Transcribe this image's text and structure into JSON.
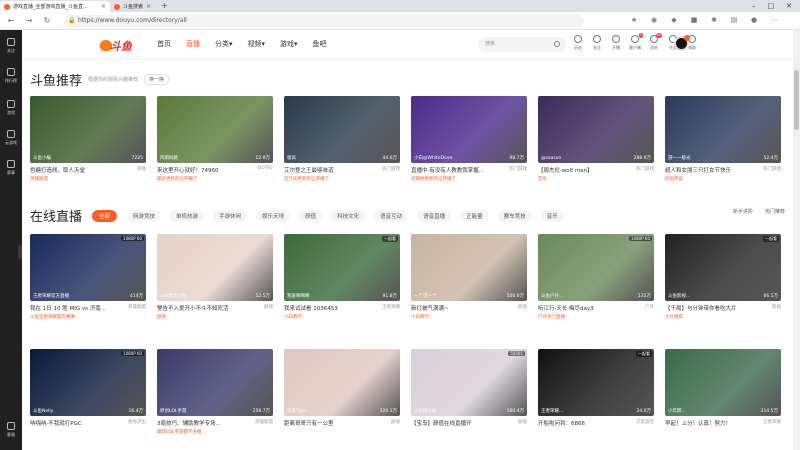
{
  "browser": {
    "tabs": [
      {
        "title": "游戏直播_全部游戏直播_斗鱼直...",
        "active": true
      },
      {
        "title": "斗鱼搜索",
        "active": false
      }
    ],
    "url": "https://www.douyu.com/directory/all",
    "new_tab": "+"
  },
  "sidebar": {
    "items": [
      {
        "label": "关注",
        "icon": "heart-icon"
      },
      {
        "label": "排行榜",
        "icon": "rank-icon"
      },
      {
        "label": "游戏",
        "icon": "game-icon"
      },
      {
        "label": "云游戏",
        "icon": "cloud-game-icon"
      },
      {
        "label": "赛事",
        "icon": "trophy-icon"
      },
      {
        "label": "客服",
        "icon": "support-icon"
      }
    ]
  },
  "header": {
    "logo_text": "斗鱼",
    "nav": [
      {
        "label": "首页"
      },
      {
        "label": "直播",
        "active": true
      },
      {
        "label": "分类▾"
      },
      {
        "label": "视频▾"
      },
      {
        "label": "游戏▾"
      },
      {
        "label": "鱼吧"
      }
    ],
    "search_placeholder": "搜索",
    "tools": [
      {
        "label": "历史",
        "badge": ""
      },
      {
        "label": "关注",
        "badge": ""
      },
      {
        "label": "开播",
        "badge": ""
      },
      {
        "label": "客户端",
        "badge": "1"
      },
      {
        "label": "消息",
        "badge": "99"
      },
      {
        "label": "任务",
        "badge": ""
      },
      {
        "label": "领取",
        "badge": ""
      }
    ]
  },
  "recommend": {
    "title": "斗鱼推荐",
    "subtitle": "根据你的观看兴趣推荐",
    "refresh": "换一换",
    "cards": [
      {
        "title": "色糖打造线，取人天堂",
        "category": "英雄",
        "anchor": "斗鱼小编",
        "viewers": "7225",
        "note": "英雄联盟",
        "color": "#3a5a2a"
      },
      {
        "title": "来这里开心就好！74960",
        "category": "DOTA2",
        "anchor": "风雨同路",
        "viewers": "12.9万",
        "note": "最近更新的让开播了",
        "color": "#5a7a3a"
      },
      {
        "title": "艾尔登之王最够味道",
        "category": "热门游戏",
        "anchor": "极高",
        "viewers": "44.6万",
        "note": "近几天更新的让开播了",
        "color": "#2a3a4a"
      },
      {
        "title": "直播中·有没有人教教我掌握...",
        "category": "热门游戏",
        "anchor": "小白@WhiteDove",
        "viewers": "98.7万",
        "note": "近期刚更新的让开播了",
        "color": "#4a2a8a"
      },
      {
        "title": "【周杰伦·wolf man】",
        "category": "热门游戏",
        "anchor": "@season",
        "viewers": "288.9万",
        "note": "音乐",
        "color": "#3a2a5a"
      },
      {
        "title": "超人和女朋三只打女节快乐",
        "category": "热门游戏",
        "anchor": "游一一极光",
        "viewers": "52.4万",
        "note": "炉石传说",
        "color": "#2a3a5a"
      }
    ]
  },
  "live": {
    "title": "在线直播",
    "all_label": "全部",
    "categories": [
      "网游竞技",
      "单机热游",
      "手游休闲",
      "娱乐天地",
      "颜值",
      "科技文化",
      "语音互动",
      "语音直播",
      "正能量",
      "赛车竞技",
      "音乐"
    ],
    "right_links": [
      "新手进阶",
      "热门推荐"
    ],
    "row1": [
      {
        "title": "我在 1日 10 胜 MIG vs 济南...",
        "category": "英雄联盟",
        "anchor": "王者荣耀官方直播",
        "viewers": "414万",
        "note": "斗鱼王者荣耀官方赛事",
        "tag": "1080P 60",
        "color": "#1a2a5a"
      },
      {
        "title": "警告不入爱开小不斗不知死活",
        "category": "颜值",
        "anchor": "vx0新晋斗鱼",
        "viewers": "12.5万",
        "note": "颜值",
        "tag": "",
        "color": "#e6d2c8"
      },
      {
        "title": "我来试试看 1036453",
        "category": "王者荣耀",
        "anchor": "我爱啊啊啊",
        "viewers": "91.8万",
        "note": "小白教学",
        "tag": "一起看",
        "color": "#3a6a3a"
      },
      {
        "title": "新打被气满满~",
        "category": "颜值",
        "anchor": "一个可一个",
        "viewers": "500.0万",
        "note": "小白教学",
        "tag": "",
        "color": "#c8b4a0"
      },
      {
        "title": "听江行·天长·梅尽day3",
        "category": "户外",
        "anchor": "斗鱼户外...",
        "viewers": "135万",
        "note": "户外热门直播",
        "tag": "1080P 60",
        "color": "#6a8a5a"
      },
      {
        "title": "【千局】与分钟带你看吃大片",
        "category": "影视",
        "anchor": "斗鱼影视...",
        "viewers": "66.5万",
        "note": "大片推荐",
        "tag": "一起看",
        "color": "#222222"
      }
    ],
    "row2": [
      {
        "title": "呐嗨呐·不我就打PGC",
        "category": "绝地求生",
        "anchor": "斗鱼Nelly",
        "viewers": "16.4万",
        "note": "",
        "tag": "1080P 60",
        "color": "#0a1a3a"
      },
      {
        "title": "3局技巧、辅助教学专场...",
        "category": "英雄联盟",
        "anchor": "原创LOL手游",
        "viewers": "258.7万",
        "note": "最新LOL手游教学主播...",
        "tag": "",
        "color": "#3a3a6a"
      },
      {
        "title": "距离哥哥只有一公里",
        "category": "颜值",
        "anchor": "温柔Tiger",
        "viewers": "320.1万",
        "note": "",
        "tag": "",
        "color": "#e0c8c0"
      },
      {
        "title": "【宝岛】颜值在线直播开",
        "category": "颜值",
        "anchor": "小妖精小仙",
        "viewers": "160.4万",
        "note": "",
        "tag": "55501",
        "color": "#d8d0d8"
      },
      {
        "title": "开船啦问到：6866",
        "category": "交友语音",
        "anchor": "王者荣耀...",
        "viewers": "24.0万",
        "note": "",
        "tag": "一起看",
        "color": "#111111"
      },
      {
        "title": "早起！上分！认真！努力！",
        "category": "王者荣耀",
        "anchor": "小年糕...",
        "viewers": "214.5万",
        "note": "",
        "tag": "",
        "color": "#3a6a4a"
      }
    ]
  },
  "colors": {
    "accent": "#ff5d23",
    "sidebar": "#202020"
  }
}
